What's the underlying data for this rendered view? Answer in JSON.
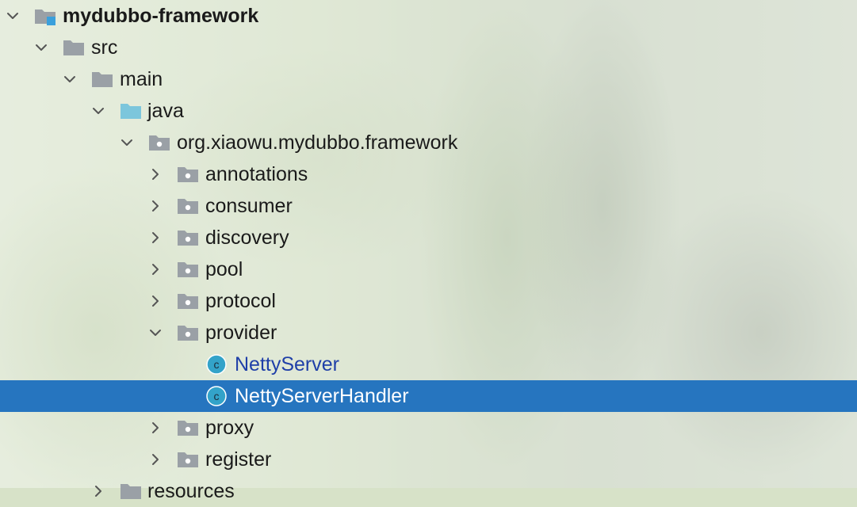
{
  "project_tree": {
    "root": {
      "label": "mydubbo-framework",
      "expanded": true
    },
    "src": {
      "label": "src",
      "expanded": true
    },
    "main": {
      "label": "main",
      "expanded": true
    },
    "java": {
      "label": "java",
      "expanded": true
    },
    "package": {
      "label": "org.xiaowu.mydubbo.framework",
      "expanded": true
    },
    "packages": [
      {
        "label": "annotations",
        "expanded": false
      },
      {
        "label": "consumer",
        "expanded": false
      },
      {
        "label": "discovery",
        "expanded": false
      },
      {
        "label": "pool",
        "expanded": false
      },
      {
        "label": "protocol",
        "expanded": false
      },
      {
        "label": "provider",
        "expanded": true
      },
      {
        "label": "proxy",
        "expanded": false
      },
      {
        "label": "register",
        "expanded": false
      }
    ],
    "provider_classes": [
      {
        "label": "NettyServer",
        "icon": "class-icon",
        "selected": false
      },
      {
        "label": "NettyServerHandler",
        "icon": "class-icon",
        "selected": true
      }
    ],
    "next": {
      "label": "resources"
    }
  },
  "colors": {
    "selection": "#2675bf",
    "class_icon": "#33a3c9",
    "source_folder": "#7cc6dc",
    "folder": "#9aa0a6",
    "modified_text": "#1f3fa8"
  }
}
